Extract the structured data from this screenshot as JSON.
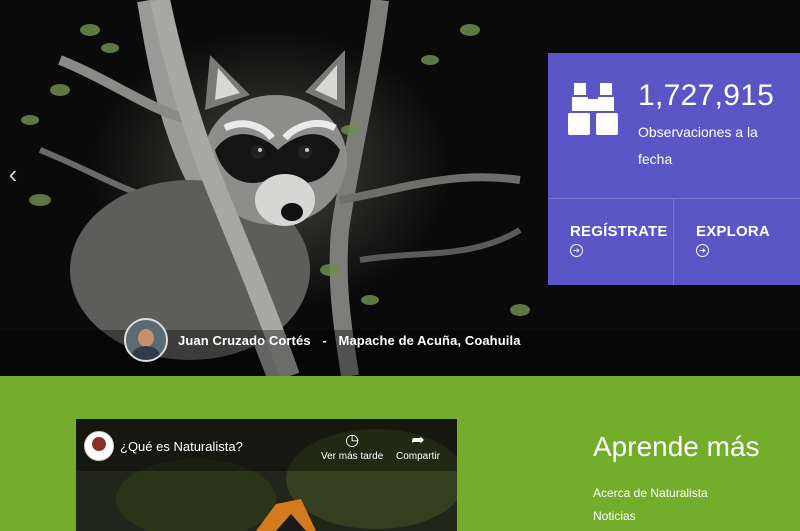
{
  "hero": {
    "credit": {
      "observer": "Juan Cruzado Cortés",
      "separator": "-",
      "species_location": "Mapache de Acuña, Coahuila"
    }
  },
  "stats": {
    "count": "1,727,915",
    "count_label": "Observaciones a la fecha",
    "signup_label": "REGÍSTRATE",
    "explore_label": "EXPLORA"
  },
  "video": {
    "title": "¿Qué es Naturalista?",
    "watch_later_label": "Ver más tarde",
    "share_label": "Compartir"
  },
  "learn_more": {
    "title": "Aprende más",
    "links": [
      "Acerca de Naturalista",
      "Noticias"
    ]
  },
  "colors": {
    "panel": "#5b56c6",
    "green": "#74ac2c"
  }
}
